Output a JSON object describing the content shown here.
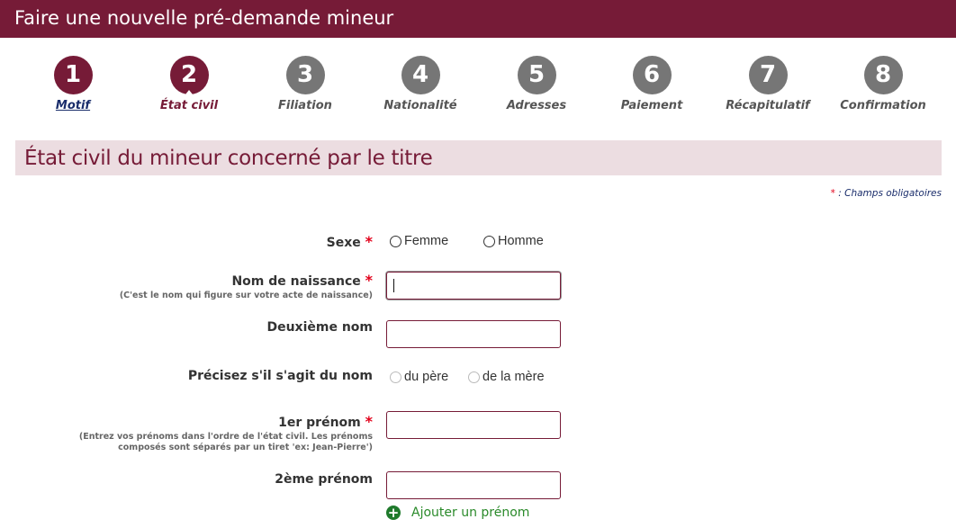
{
  "header": {
    "title": "Faire une nouvelle pré-demande mineur"
  },
  "stepper": {
    "steps": [
      {
        "number": "1",
        "label": "Motif",
        "state": "done"
      },
      {
        "number": "2",
        "label": "État civil",
        "state": "active"
      },
      {
        "number": "3",
        "label": "Filiation",
        "state": "todo"
      },
      {
        "number": "4",
        "label": "Nationalité",
        "state": "todo"
      },
      {
        "number": "5",
        "label": "Adresses",
        "state": "todo"
      },
      {
        "number": "6",
        "label": "Paiement",
        "state": "todo"
      },
      {
        "number": "7",
        "label": "Récapitulatif",
        "state": "todo"
      },
      {
        "number": "8",
        "label": "Confirmation",
        "state": "todo"
      }
    ]
  },
  "section": {
    "title": "État civil du mineur concerné par le titre",
    "required_star": "*",
    "required_note": " : Champs obligatoires"
  },
  "form": {
    "star": "*",
    "sexe": {
      "label": "Sexe",
      "options": [
        "Femme",
        "Homme"
      ],
      "selected": null
    },
    "nom_naissance": {
      "label": "Nom de naissance",
      "help": "(C'est le nom qui figure sur votre acte de naissance)",
      "value": ""
    },
    "deuxieme_nom": {
      "label": "Deuxième nom",
      "value": ""
    },
    "origine_nom": {
      "label": "Précisez s'il s'agit du nom",
      "options": [
        "du père",
        "de la mère"
      ],
      "selected": null
    },
    "prenom1": {
      "label": "1er prénom",
      "help_line1": "(Entrez vos prénoms dans l'ordre de l'état civil. Les prénoms",
      "help_line2": "composés sont séparés par un tiret 'ex: Jean-Pierre')",
      "value": ""
    },
    "prenom2": {
      "label": "2ème prénom",
      "value": ""
    },
    "add_prenom": {
      "label": "Ajouter un prénom",
      "icon": "plus-circle-icon"
    }
  },
  "colors": {
    "brand": "#761b37",
    "section_bg": "#ecdde1",
    "step_inactive": "#767676",
    "required": "#e2001a",
    "link_done": "#1a2d6b",
    "add_green": "#1f7a2c"
  }
}
